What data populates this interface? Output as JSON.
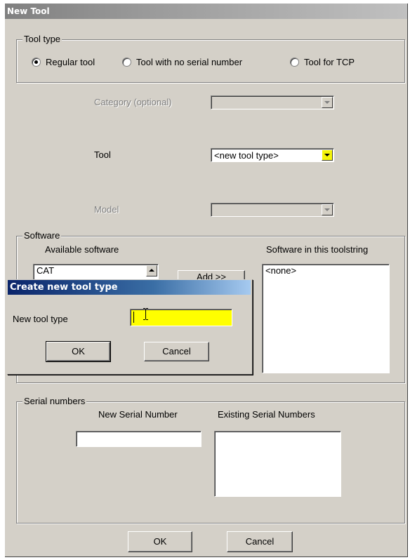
{
  "window": {
    "title": "New Tool"
  },
  "tool_type": {
    "legend": "Tool type",
    "options": [
      {
        "label": "Regular tool",
        "checked": true
      },
      {
        "label": "Tool with no serial number",
        "checked": false
      },
      {
        "label": "Tool for TCP",
        "checked": false
      }
    ]
  },
  "category": {
    "label": "Category (optional)",
    "value": ""
  },
  "tool": {
    "label": "Tool",
    "value": "<new tool type>",
    "button_color": "#f4f40a"
  },
  "model": {
    "label": "Model",
    "value": ""
  },
  "software": {
    "legend": "Software",
    "available_label": "Available software",
    "available_items": [
      "CAT"
    ],
    "add_button_label": "Add >>",
    "toolstring_label": "Software in this toolstring",
    "toolstring_items": [
      "<none>"
    ]
  },
  "serial_numbers": {
    "legend": "Serial numbers",
    "new_label": "New Serial Number",
    "new_value": "",
    "existing_label": "Existing Serial Numbers"
  },
  "buttons": {
    "ok": "OK",
    "cancel": "Cancel"
  },
  "dialog": {
    "title": "Create new tool type",
    "field_label": "New tool type",
    "field_value": "",
    "field_color": "#ffff00",
    "ok": "OK",
    "cancel": "Cancel"
  }
}
